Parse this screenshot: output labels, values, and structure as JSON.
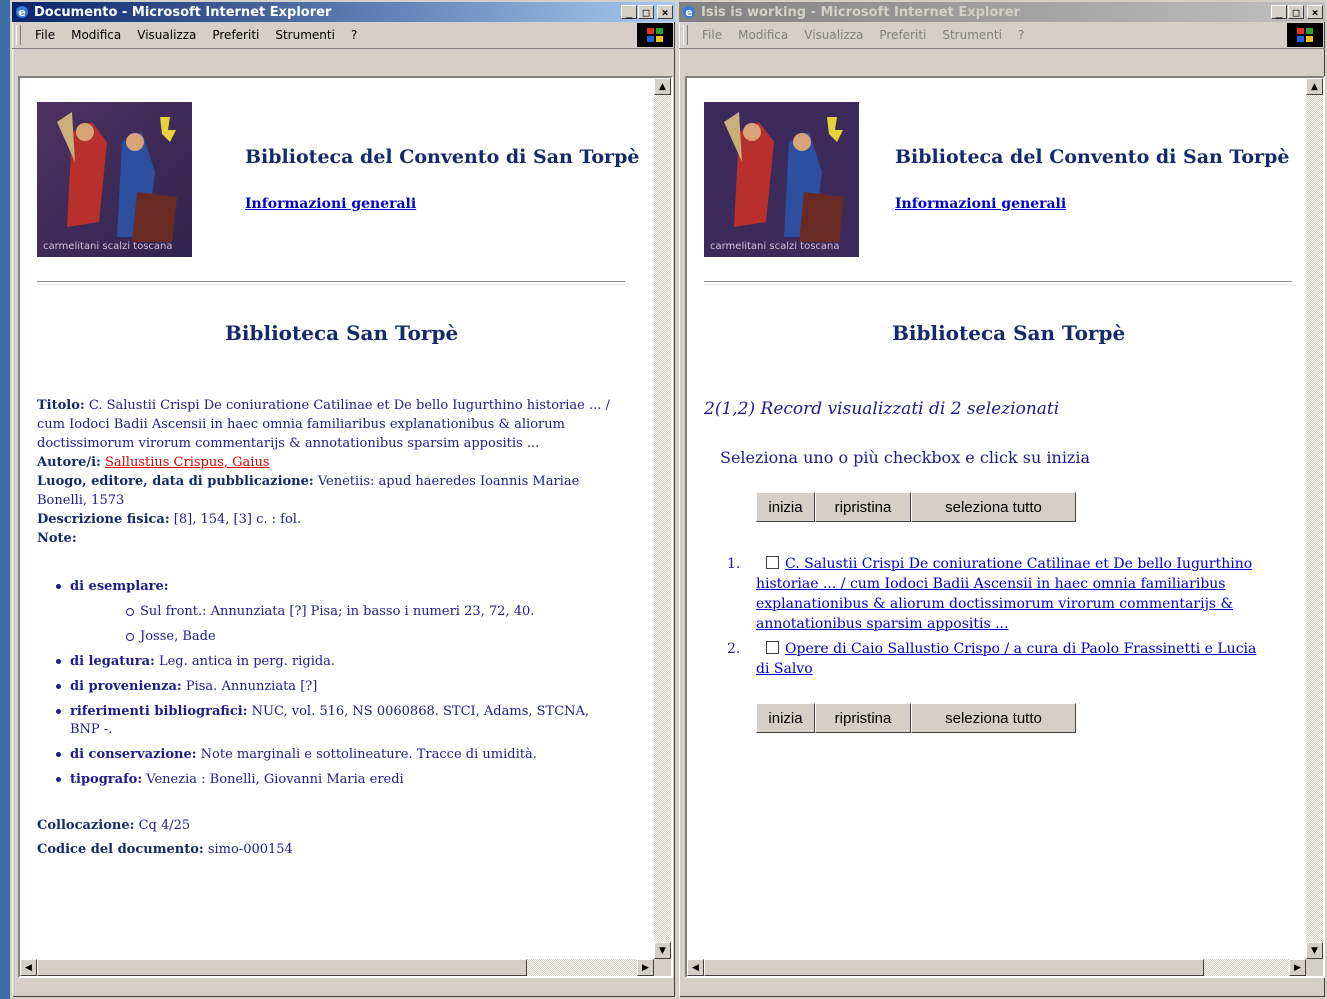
{
  "left_window": {
    "title": "Documento - Microsoft Internet Explorer",
    "menu": [
      "File",
      "Modifica",
      "Visualizza",
      "Preferiti",
      "Strumenti",
      "?"
    ],
    "header_title": "Biblioteca del Convento di San Torpè",
    "header_link": "Informazioni generali",
    "logo_text": "carmelitani scalzi toscana",
    "library_title": "Biblioteca San Torpè",
    "record": {
      "titolo_label": "Titolo:",
      "titolo": "C. Salustii Crispi De coniuratione Catilinae et De bello Iugurthino historiae ... / cum Iodoci Badii Ascensii in haec omnia familiaribus explanationibus & aliorum doctissimorum virorum commentarijs & annotationibus sparsim appositis ...",
      "autore_label": "Autore/i:",
      "autore": "Sallustius Crispus, Gaius",
      "luogo_label": "Luogo, editore, data di pubblicazione:",
      "luogo": "Venetiis: apud haeredes Ioannis Mariae Bonelli, 1573",
      "descr_label": "Descrizione fisica:",
      "descr": "[8], 154, [3] c. : fol.",
      "note_label": "Note:"
    },
    "notes": {
      "esemplare_label": "di esemplare:",
      "esemplare_sub1": "Sul front.: Annunziata [?] Pisa; in basso i numeri 23, 72, 40.",
      "esemplare_sub2": "Josse, Bade",
      "legatura_label": "di legatura:",
      "legatura": "Leg. antica in perg. rigida.",
      "provenienza_label": "di provenienza:",
      "provenienza": "Pisa. Annunziata [?]",
      "riferimenti_label": "riferimenti bibliografici:",
      "riferimenti": "NUC, vol. 516, NS 0060868. STCI, Adams, STCNA, BNP -.",
      "conservazione_label": "di conservazione:",
      "conservazione": "Note marginali e sottolineature. Tracce di umidità.",
      "tipografo_label": "tipografo:",
      "tipografo": "Venezia : Bonelli, Giovanni Maria eredi"
    },
    "collocazione_label": "Collocazione:",
    "collocazione": "Cq 4/25",
    "codice_label": "Codice del documento:",
    "codice": "simo-000154"
  },
  "right_window": {
    "title": "Isis is working - Microsoft Internet Explorer",
    "menu": [
      "File",
      "Modifica",
      "Visualizza",
      "Preferiti",
      "Strumenti",
      "?"
    ],
    "header_title": "Biblioteca del Convento di San Torpè",
    "header_link": "Informazioni generali",
    "logo_text": "carmelitani scalzi toscana",
    "library_title": "Biblioteca San Torpè",
    "records_shown": "2(1,2) Record visualizzati di 2 selezionati",
    "instruction": "Seleziona uno o più checkbox e click su inizia",
    "buttons": {
      "start": "inizia",
      "reset": "ripristina",
      "select_all": "seleziona tutto"
    },
    "results": [
      {
        "num": "1.",
        "text": "C. Salustii Crispi De coniuratione Catilinae et De bello Iugurthino historiae ... / cum Iodoci Badii Ascensii in haec omnia familiaribus explanationibus & aliorum doctissimorum virorum commentarijs & annotationibus sparsim appositis ..."
      },
      {
        "num": "2.",
        "text": "Opere di Caio Sallustio Crispo / a cura di Paolo Frassinetti e Lucia di Salvo"
      }
    ]
  },
  "colors": {
    "title_active": "#0a246a",
    "text_navy": "#1c1c8c",
    "link": "#0000cc",
    "author_red": "#dd0000"
  }
}
